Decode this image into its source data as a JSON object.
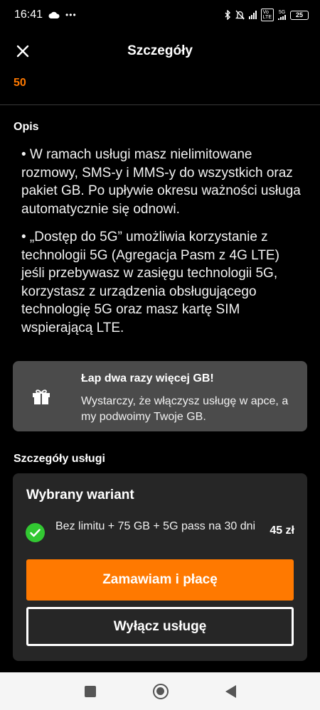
{
  "status_bar": {
    "time": "16:41",
    "more": "•••",
    "network": "5G",
    "battery": "25"
  },
  "header": {
    "title": "Szczegóły"
  },
  "top_price": "50",
  "description": {
    "label": "Opis",
    "bullets": [
      "• W ramach usługi masz nielimitowane rozmowy, SMS-y i MMS-y do wszystkich oraz pakiet GB. Po upływie okresu ważności usługa automatycznie się odnowi.",
      "• „Dostęp do 5G” umożliwia korzystanie z technologii 5G (Agregacja Pasm z 4G LTE) jeśli przebywasz w zasięgu technologii 5G, korzystasz z urządzenia obsługującego technologię 5G oraz masz kartę SIM wspierającą LTE."
    ]
  },
  "promo": {
    "title": "Łap dwa razy więcej GB!",
    "text": "Wystarczy, że włączysz usługę w apce, a my podwoimy Twoje GB."
  },
  "service_details": {
    "label": "Szczegóły usługi",
    "card_title": "Wybrany wariant",
    "variant_name": "Bez limitu + 75 GB + 5G pass na 30 dni",
    "variant_price": "45 zł",
    "order_button": "Zamawiam i płacę",
    "disable_button": "Wyłącz usługę"
  },
  "colors": {
    "accent": "#ff7900",
    "check": "#32c832",
    "card": "#262626",
    "promo": "#4b4b4b"
  }
}
